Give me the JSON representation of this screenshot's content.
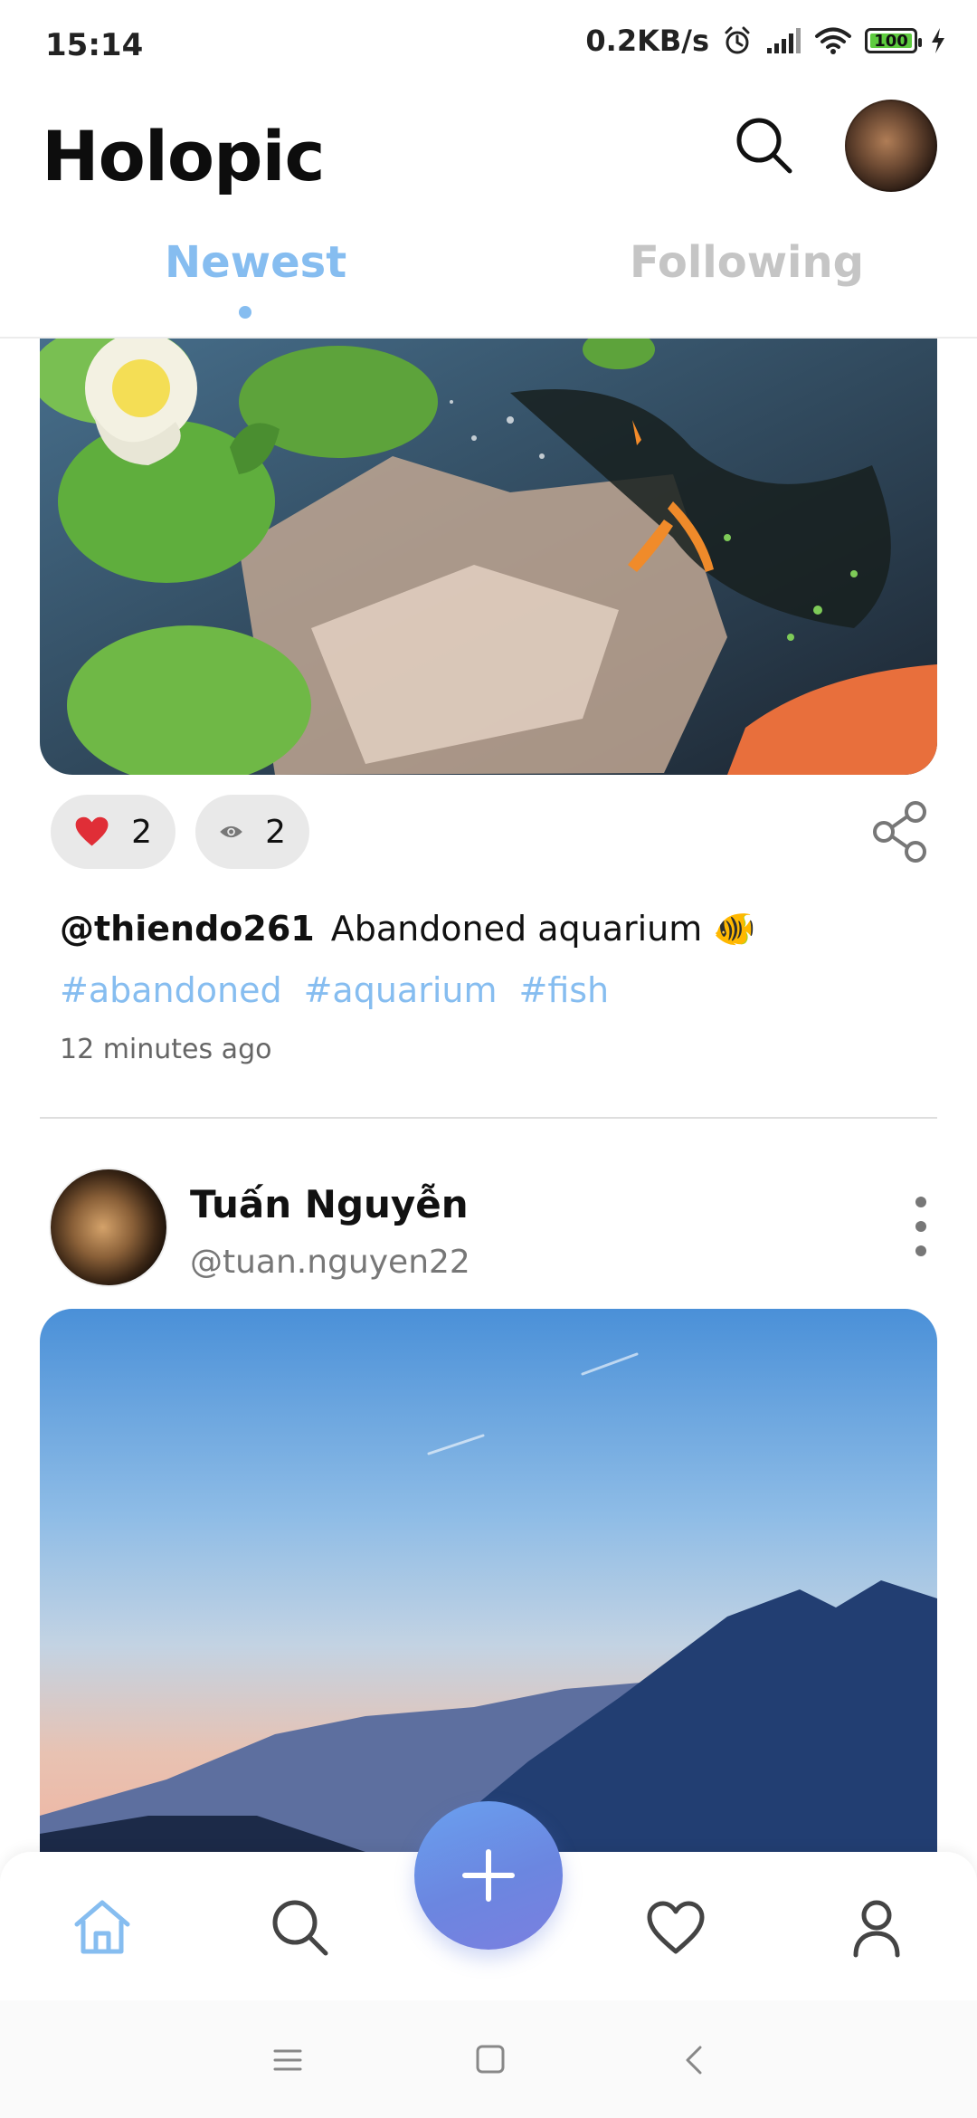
{
  "status_bar": {
    "time": "15:14",
    "network_speed": "0.2KB/s",
    "battery_level": "100"
  },
  "header": {
    "title": "Holopic"
  },
  "tabs": [
    {
      "label": "Newest",
      "active": true
    },
    {
      "label": "Following",
      "active": false
    }
  ],
  "post1": {
    "likes": "2",
    "views": "2",
    "username": "@thiendo261",
    "caption": "Abandoned aquarium 🐠",
    "tags": [
      "#abandoned",
      "#aquarium",
      "#fish"
    ],
    "time_ago": "12 minutes ago"
  },
  "post2": {
    "author_name": "Tuấn Nguyễn",
    "author_handle": "@tuan.nguyen22"
  },
  "colors": {
    "accent": "#86bdf0",
    "fab_gradient_start": "#6aa0ef",
    "fab_gradient_end": "#7b7fe0",
    "inactive_tab": "#c5c5c5"
  },
  "icons": {
    "header": [
      "search-icon",
      "avatar"
    ],
    "post1": [
      "heart-icon",
      "eye-icon",
      "share-icon"
    ],
    "post2": [
      "more-vertical-icon"
    ],
    "bottom_nav": [
      "home-icon",
      "search-icon",
      "plus-icon",
      "heart-icon",
      "user-icon"
    ],
    "system_nav": [
      "menu-icon",
      "home-square-icon",
      "back-icon"
    ]
  }
}
